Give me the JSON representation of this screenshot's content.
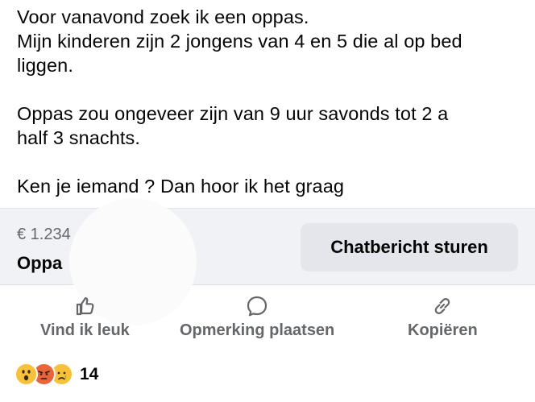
{
  "post": {
    "line1": "Voor vanavond zoek ik een oppas.",
    "line2": "Mijn kinderen zijn 2 jongens van 4 en 5 die al op bed",
    "line3": "liggen.",
    "line4": "Oppas zou ongeveer zijn van 9 uur savonds tot 2 a",
    "line5": "half 3 snachts.",
    "line6": "Ken je iemand ? Dan hoor ik het graag"
  },
  "listing": {
    "price": "€ 1.234",
    "title": "Oppa",
    "chat_button": "Chatbericht sturen",
    "background_color": "#f0f2f5"
  },
  "actions": {
    "like": {
      "label": "Vind ik leuk",
      "icon": "thumbs-up-icon"
    },
    "comment": {
      "label": "Opmerking plaatsen",
      "icon": "comment-icon"
    },
    "copy": {
      "label": "Kopiëren",
      "icon": "link-icon"
    }
  },
  "reactions": {
    "icons": [
      "wow-reaction-icon",
      "angry-reaction-icon",
      "sad-reaction-icon"
    ],
    "count": "14"
  }
}
